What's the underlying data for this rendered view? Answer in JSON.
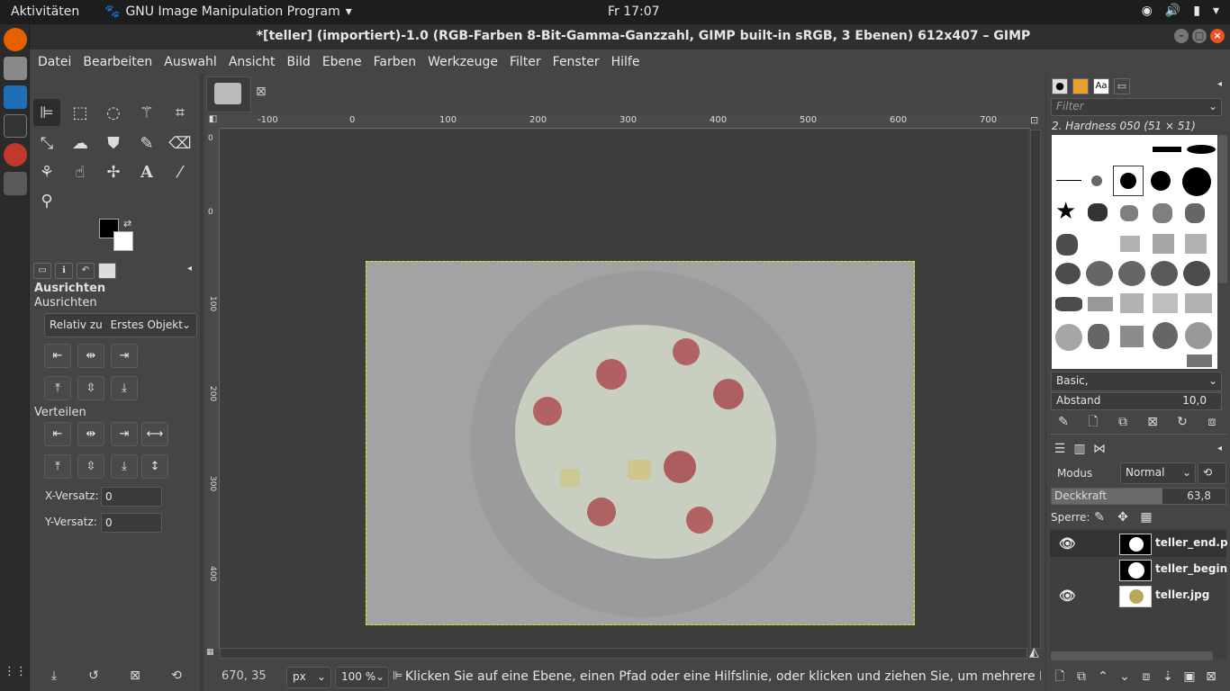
{
  "topbar": {
    "activities": "Aktivitäten",
    "app_menu": "GNU Image Manipulation Program",
    "clock": "Fr 17:07"
  },
  "window": {
    "title": "*[teller] (importiert)-1.0 (RGB-Farben 8-Bit-Gamma-Ganzzahl, GIMP built-in sRGB, 3 Ebenen) 612x407 – GIMP"
  },
  "menubar": [
    "Datei",
    "Bearbeiten",
    "Auswahl",
    "Ansicht",
    "Bild",
    "Ebene",
    "Farben",
    "Werkzeuge",
    "Filter",
    "Fenster",
    "Hilfe"
  ],
  "tool_options": {
    "header": "Ausrichten",
    "subheader": "Ausrichten",
    "relative_label": "Relativ zu",
    "relative_value": "Erstes Objekt",
    "distribute_label": "Verteilen",
    "x_offset_label": "X-Versatz:",
    "x_offset_value": "0",
    "y_offset_label": "Y-Versatz:",
    "y_offset_value": "0"
  },
  "ruler": {
    "top_ticks": [
      "-100",
      "0",
      "100",
      "200",
      "300",
      "400",
      "500",
      "600",
      "700"
    ],
    "left_ticks": [
      "0",
      "0",
      "100",
      "200",
      "300",
      "400"
    ]
  },
  "statusbar": {
    "coords": "670, 35",
    "unit": "px",
    "zoom": "100 %",
    "message": "Klicken Sie auf eine Ebene, einen Pfad oder eine Hilfslinie, oder klicken und ziehen Sie, um mehrere Eben…"
  },
  "brushes": {
    "filter_placeholder": "Filter",
    "selected": "2. Hardness 050 (51 × 51)",
    "preset": "Basic,",
    "spacing_label": "Abstand",
    "spacing_value": "10,0"
  },
  "layers": {
    "mode_label": "Modus",
    "mode_value": "Normal",
    "opacity_label": "Deckkraft",
    "opacity_value": "63,8",
    "opacity_fraction": 0.638,
    "lock_label": "Sperre:",
    "items": [
      {
        "name": "teller_end.png",
        "visible": true
      },
      {
        "name": "teller_begin.png",
        "visible": false
      },
      {
        "name": "teller.jpg",
        "visible": true
      }
    ]
  }
}
